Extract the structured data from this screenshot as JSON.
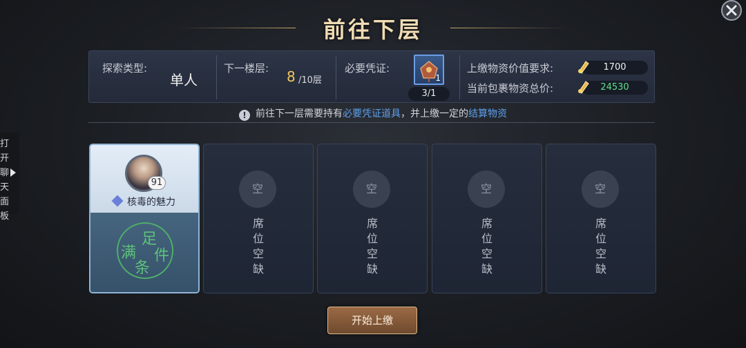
{
  "title": "前往下层",
  "info": {
    "explore_type_label": "探索类型:",
    "explore_type_value": "单人",
    "next_floor_label": "下一楼层:",
    "next_floor_current": "8",
    "next_floor_total": "/10层",
    "credential_label": "必要凭证:",
    "credential_qty": "1",
    "credential_count": "3/1",
    "required_value_label": "上缴物资价值要求:",
    "required_value": "1700",
    "current_value_label": "当前包裹物资总价:",
    "current_value": "24530"
  },
  "notice": {
    "prefix": "前往下一层需要持有",
    "highlight1": "必要凭证道具",
    "middle": "，并上缴一定的",
    "highlight2": "结算物资"
  },
  "side_tab": {
    "text": "打\n开\n聊\n天\n面\n板"
  },
  "seats": {
    "filled": {
      "level": "91",
      "name": "核毒的魅力",
      "stamp": [
        "满",
        "足",
        "条",
        "件"
      ]
    },
    "empty_circle": "空",
    "empty_text": "席\n位\n空\n缺"
  },
  "start_button": "开始上缴",
  "colors": {
    "gold_title": "#f1dcb4",
    "floor_highlight": "#f2c75e",
    "link_blue": "#5ea0ec",
    "current_value_green": "#5fe08a",
    "stamp_green": "#5ec27a"
  }
}
